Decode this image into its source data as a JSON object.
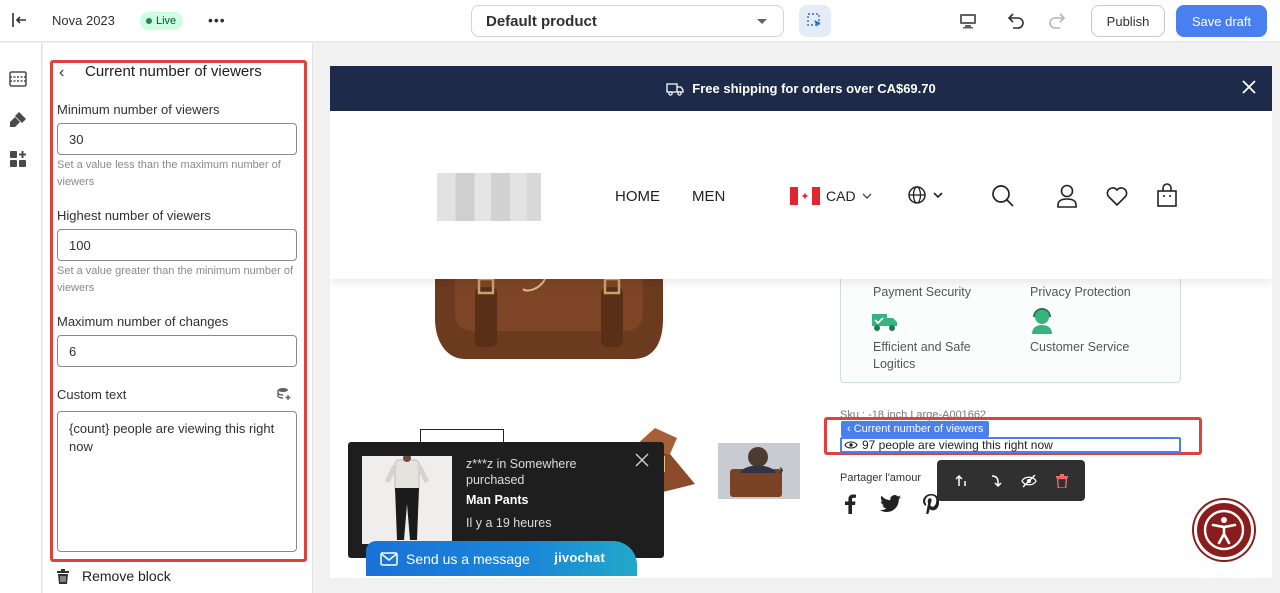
{
  "topbar": {
    "store_name": "Nova 2023",
    "status_badge": "Live",
    "template_select": "Default product",
    "publish_label": "Publish",
    "save_label": "Save draft"
  },
  "panel": {
    "title": "Current number of viewers",
    "fields": [
      {
        "label": "Minimum number of viewers",
        "value": "30",
        "help": "Set a value less than the maximum number of viewers"
      },
      {
        "label": "Highest number of viewers",
        "value": "100",
        "help": "Set a value greater than the minimum number of viewers"
      },
      {
        "label": "Maximum number of changes",
        "value": "6"
      }
    ],
    "custom_text": {
      "label": "Custom text",
      "value": "{count} people are viewing this right now"
    },
    "remove_label": "Remove block"
  },
  "preview": {
    "announcement": "Free shipping for orders over CA$69.70",
    "nav": [
      "HOME",
      "MEN"
    ],
    "currency": "CAD",
    "trust": [
      "Payment Security",
      "Privacy Protection",
      "Efficient and Safe Logitics",
      "Customer Service"
    ],
    "sku": "Sku : -18 inch Large-A001662",
    "block_tag": "Current number of viewers",
    "viewer_text": "97 people are viewing this right now",
    "share_label": "Partager l'amour"
  },
  "sales_popup": {
    "line1": "z***z in Somewhere",
    "line2": "purchased",
    "product": "Man Pants",
    "time": "Il y a 19 heures"
  },
  "chat": {
    "label": "Send us a message",
    "brand": "jivochat"
  },
  "colors": {
    "accent": "#4a7ff0",
    "highlight": "#e0413d",
    "announcement_bg": "#1e2a4a"
  }
}
